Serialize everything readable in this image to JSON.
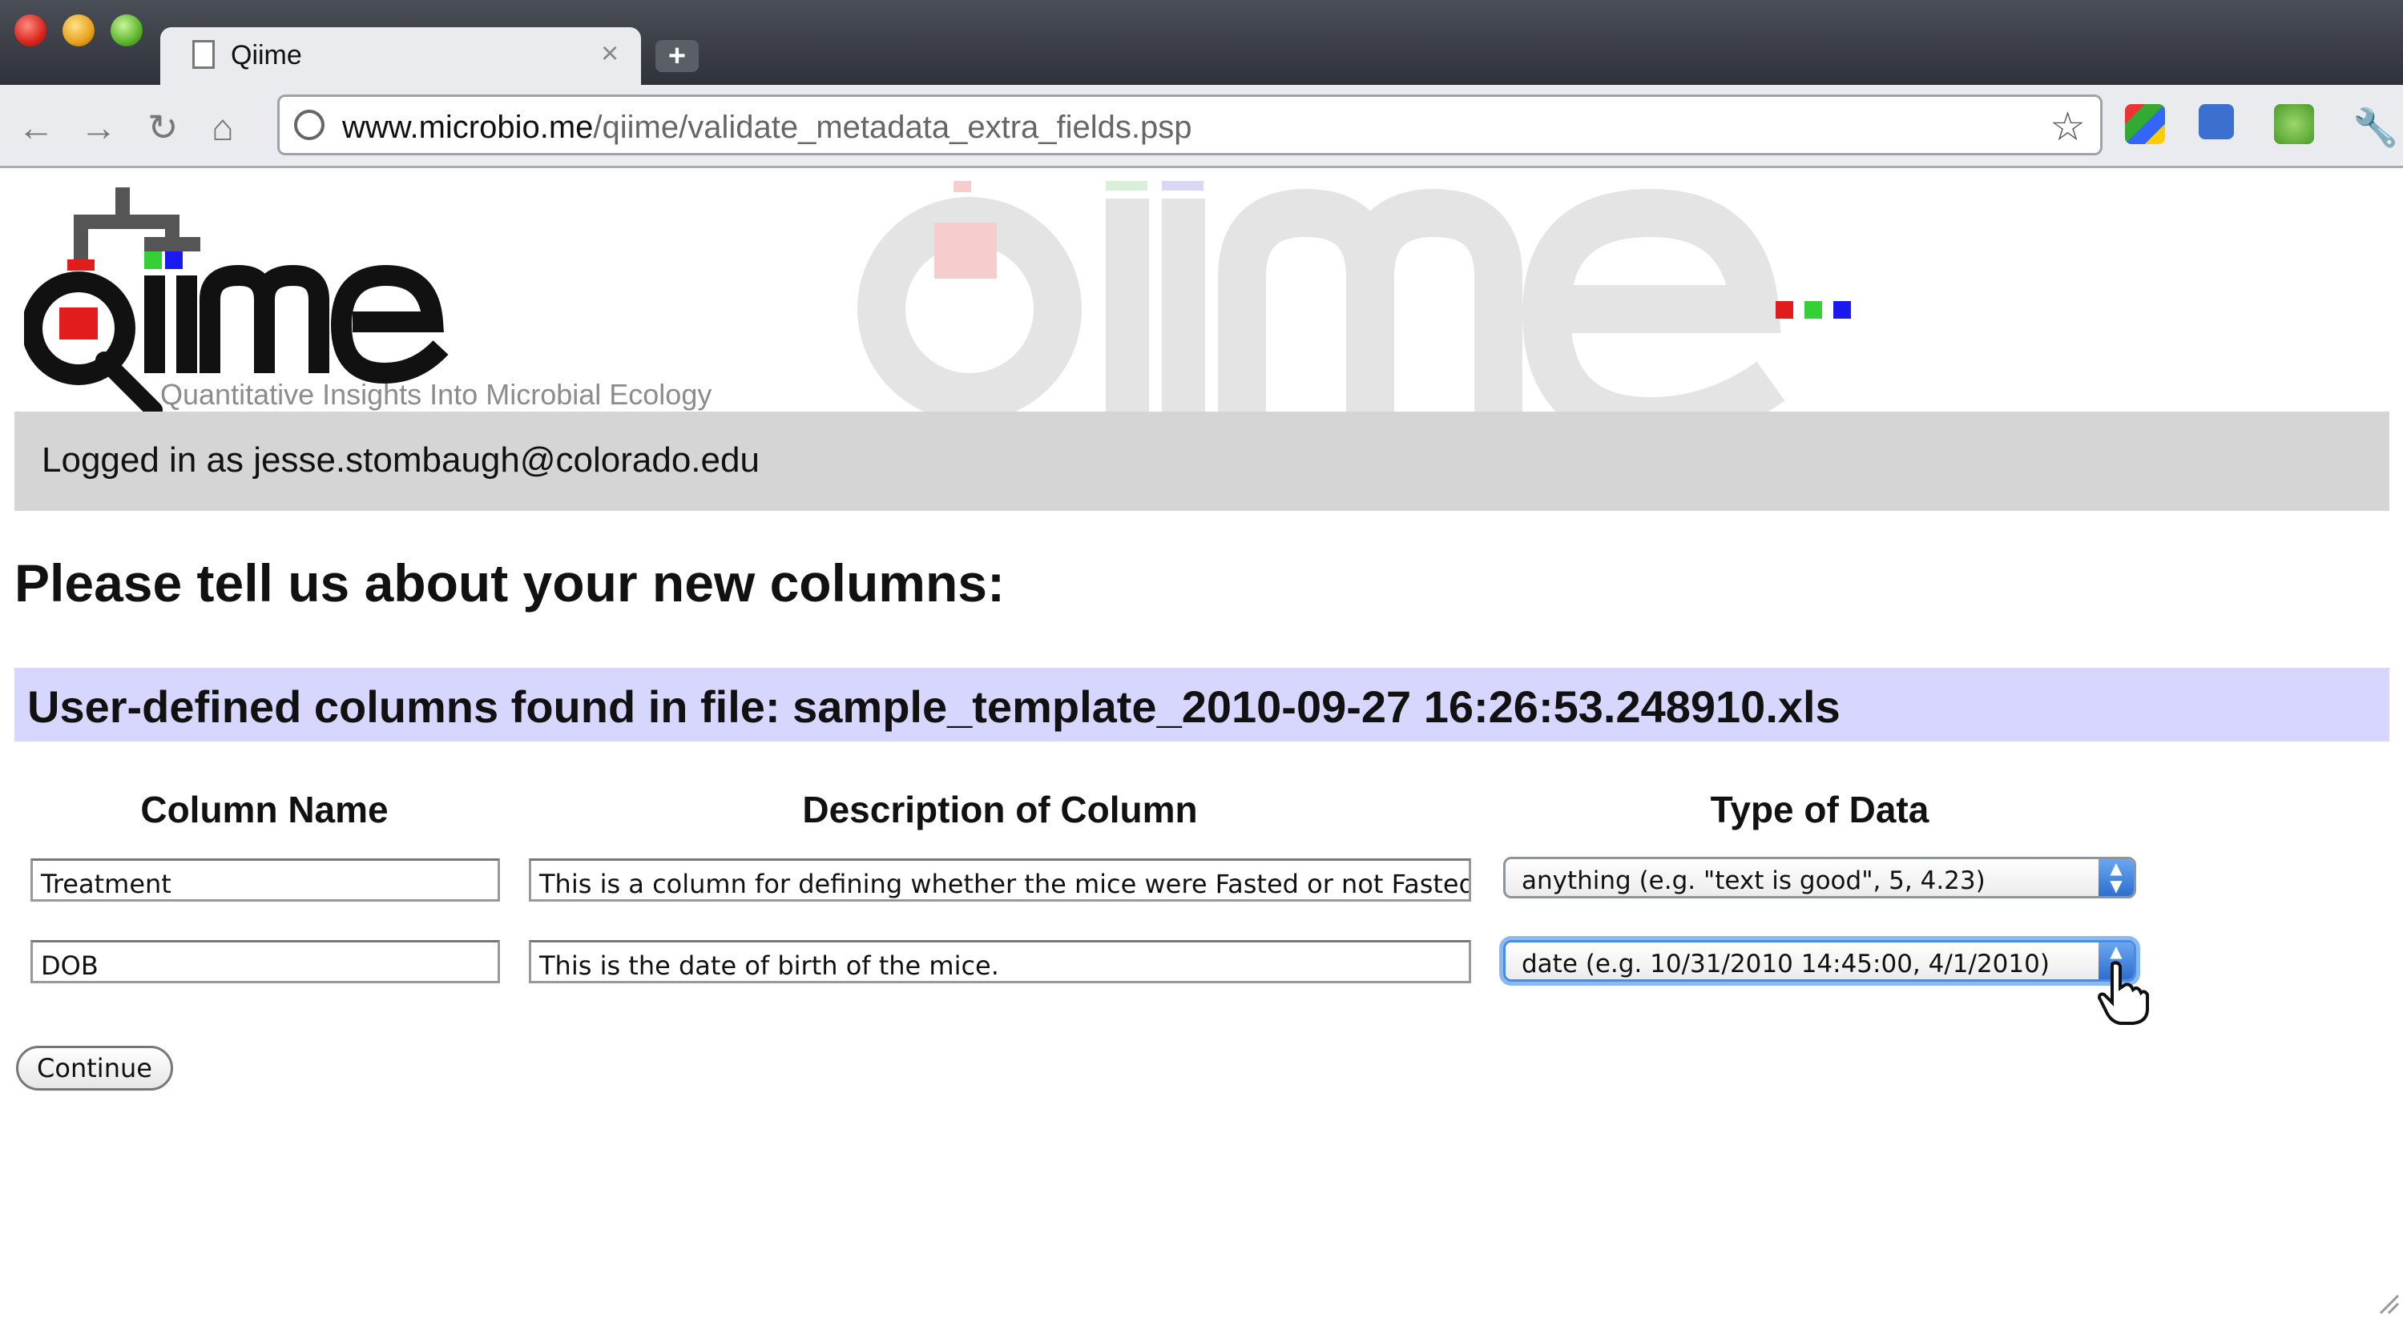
{
  "browser": {
    "tab_title": "Qiime",
    "tab_close_glyph": "×",
    "new_tab_glyph": "+",
    "url_domain": "www.microbio.me",
    "url_path": "/qiime/validate_metadata_extra_fields.psp",
    "icons": [
      "back-icon",
      "forward-icon",
      "reload-icon",
      "home-icon",
      "globe-icon",
      "star-icon",
      "wrench-icon"
    ]
  },
  "header": {
    "tagline": "Quantitative Insights Into Microbial Ecology",
    "login_text": "Logged in as jesse.stombaugh@colorado.edu"
  },
  "main": {
    "title": "Please tell us about your new columns:",
    "file_heading": "User-defined columns found in file: sample_template_2010-09-27 16:26:53.248910.xls",
    "columns": [
      "Column Name",
      "Description of Column",
      "Type of Data"
    ],
    "rows": [
      {
        "name": "Treatment",
        "description": "This is a column for defining whether the mice were Fasted or not Fasted.",
        "type": "anything (e.g. \"text is good\", 5, 4.23)"
      },
      {
        "name": "DOB",
        "description": "This is the date of birth of the mice.",
        "type": "date (e.g. 10/31/2010 14:45:00, 4/1/2010)"
      }
    ],
    "continue_label": "Continue"
  },
  "colors": {
    "login_bar": "#d5d5d5",
    "file_bar": "#d6d6ff",
    "logo_red": "#e21c1c",
    "logo_green": "#35d035",
    "logo_blue": "#1a1af0"
  }
}
